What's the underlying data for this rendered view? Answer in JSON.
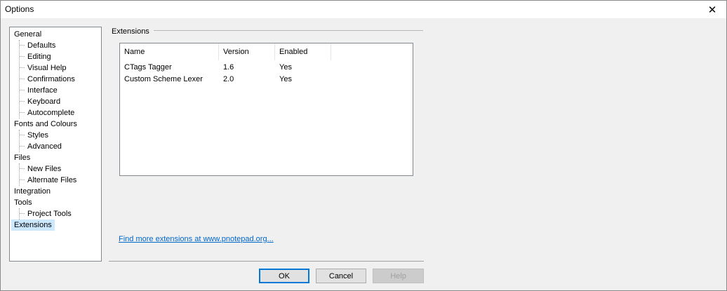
{
  "window": {
    "title": "Options"
  },
  "tree": {
    "items": [
      {
        "label": "General"
      },
      {
        "label": "Defaults"
      },
      {
        "label": "Editing"
      },
      {
        "label": "Visual Help"
      },
      {
        "label": "Confirmations"
      },
      {
        "label": "Interface"
      },
      {
        "label": "Keyboard"
      },
      {
        "label": "Autocomplete"
      },
      {
        "label": "Fonts and Colours"
      },
      {
        "label": "Styles"
      },
      {
        "label": "Advanced"
      },
      {
        "label": "Files"
      },
      {
        "label": "New Files"
      },
      {
        "label": "Alternate Files"
      },
      {
        "label": "Integration"
      },
      {
        "label": "Tools"
      },
      {
        "label": "Project Tools"
      },
      {
        "label": "Extensions",
        "selected": true
      }
    ]
  },
  "extensions": {
    "group_label": "Extensions",
    "columns": [
      "Name",
      "Version",
      "Enabled"
    ],
    "rows": [
      {
        "name": "CTags Tagger",
        "version": "1.6",
        "enabled": "Yes"
      },
      {
        "name": "Custom Scheme Lexer",
        "version": "2.0",
        "enabled": "Yes"
      }
    ],
    "more_link": "Find more extensions at www.pnotepad.org..."
  },
  "buttons": {
    "ok": "OK",
    "cancel": "Cancel",
    "help": "Help"
  }
}
